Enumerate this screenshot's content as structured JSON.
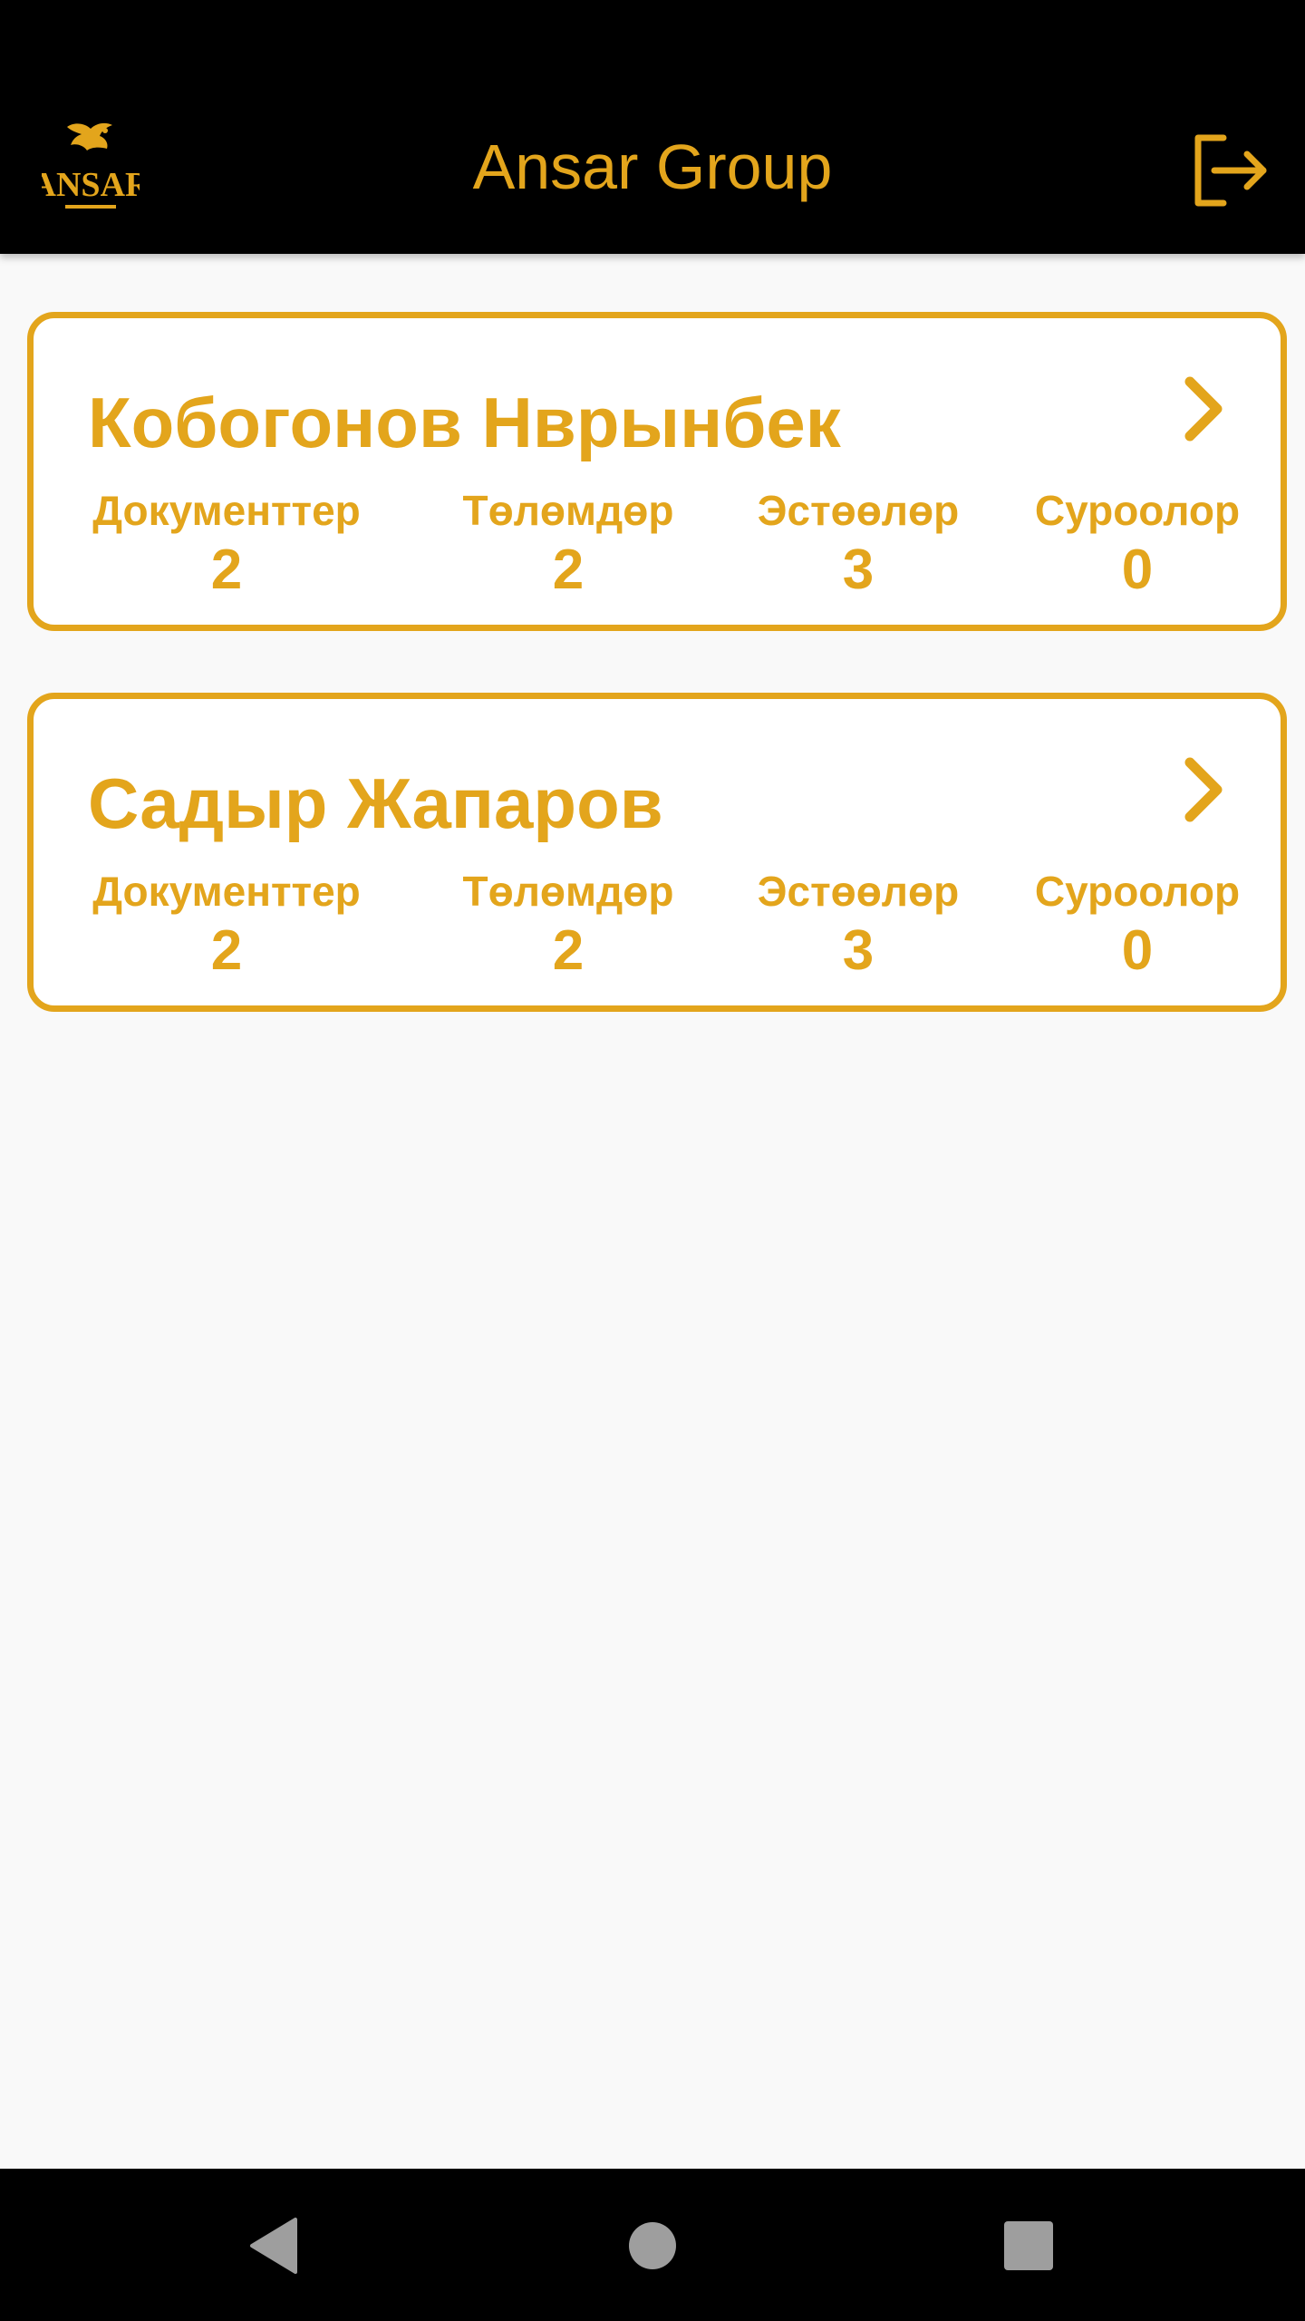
{
  "header": {
    "title": "Ansar Group",
    "logo_text": "ANSAR",
    "accent_color": "#e3a51c",
    "logo_icon": "bird-logo-icon",
    "logout_icon": "logout-icon"
  },
  "cards": [
    {
      "name": "Кобогонов  Нврынбек",
      "stats": [
        {
          "label": "Документтер",
          "value": "2"
        },
        {
          "label": "Төлөмдөр",
          "value": "2"
        },
        {
          "label": "Эстөөлөр",
          "value": "3"
        },
        {
          "label": "Суроолор",
          "value": "0"
        }
      ]
    },
    {
      "name": "Садыр  Жапаров",
      "stats": [
        {
          "label": "Документтер",
          "value": "2"
        },
        {
          "label": "Төлөмдөр",
          "value": "2"
        },
        {
          "label": "Эстөөлөр",
          "value": "3"
        },
        {
          "label": "Суроолор",
          "value": "0"
        }
      ]
    }
  ],
  "navigation": {
    "back_icon": "back-triangle-icon",
    "home_icon": "home-circle-icon",
    "recents_icon": "recents-square-icon"
  }
}
